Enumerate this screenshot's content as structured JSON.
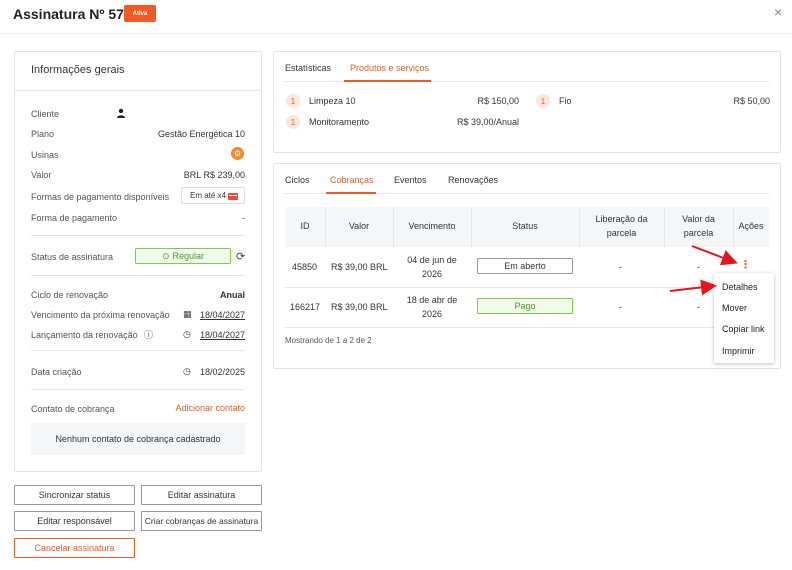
{
  "header": {
    "title": "Assinatura Nº 5747",
    "status_badge": "Ativa",
    "close": "×"
  },
  "info": {
    "title": "Informações gerais",
    "cliente_label": "Cliente",
    "plano_label": "Plano",
    "plano_value": "Gestão Energética 10",
    "usinas_label": "Usinas",
    "valor_label": "Valor",
    "valor_value": "BRL R$ 239,00",
    "formas_label": "Formas de pagamento disponíveis",
    "formas_value": "Em até x4",
    "forma_label": "Forma de pagamento",
    "forma_value": "-",
    "status_label": "Status de assinatura",
    "status_value": "Regular",
    "ciclo_label": "Ciclo de renovação",
    "ciclo_value": "Anual",
    "venc_label": "Vencimento da próxima renovação",
    "venc_value": "18/04/2027",
    "lanc_label": "Lançamento da renovação",
    "lanc_value": "18/04/2027",
    "criacao_label": "Data criação",
    "criacao_value": "18/02/2025",
    "contato_label": "Contato de cobrança",
    "contato_add": "Adicionar contato",
    "no_contact": "Nenhum contato de cobrança cadastrado"
  },
  "buttons": {
    "sync": "Sincronizar status",
    "edit_sub": "Editar assinatura",
    "edit_resp": "Editar responsável",
    "create_charges": "Criar cobranças de assinatura",
    "cancel": "Cancelar assinatura"
  },
  "products": {
    "tabs": [
      "Estatísticas",
      "Produtos e serviços"
    ],
    "items": [
      {
        "qty": "1",
        "name": "Limpeza 10",
        "price": "R$ 150,00"
      },
      {
        "qty": "1",
        "name": "Fio",
        "price": "R$ 50,00"
      },
      {
        "qty": "1",
        "name": "Monitoramento",
        "price": "R$ 39,00/Anual"
      }
    ]
  },
  "charges": {
    "tabs": [
      "Ciclos",
      "Cobranças",
      "Eventos",
      "Renovações"
    ],
    "headers": {
      "id": "ID",
      "valor": "Valor",
      "venc": "Vencimento",
      "status": "Status",
      "lib1": "Liberação da",
      "lib2": "parcela",
      "vp1": "Valor da",
      "vp2": "parcela",
      "acoes": "Ações"
    },
    "rows": [
      {
        "id": "45850",
        "valor": "R$ 39,00  BRL",
        "venc1": "04 de jun de",
        "venc2": "2026",
        "status": "Em aberto",
        "lib": "-",
        "vp": "-"
      },
      {
        "id": "166217",
        "valor": "R$ 39,00  BRL",
        "venc1": "18 de abr de",
        "venc2": "2026",
        "status": "Pago",
        "lib": "-",
        "vp": "-"
      }
    ],
    "showing": "Mostrando de 1 a 2 de 2"
  },
  "menu": {
    "items": [
      "Detalhes",
      "Mover",
      "Copiar link",
      "Imprimir"
    ]
  },
  "colors": {
    "accent": "#f15a24",
    "success": "#7ccb4c",
    "annotation_arrow": "#e8141b"
  },
  "icons": [
    "person-icon",
    "usina-icon",
    "credit-card-icon",
    "refresh-icon",
    "clock-icon",
    "calendar-icon",
    "help-icon",
    "close-icon",
    "more-vertical-icon",
    "arrow-icon"
  ]
}
